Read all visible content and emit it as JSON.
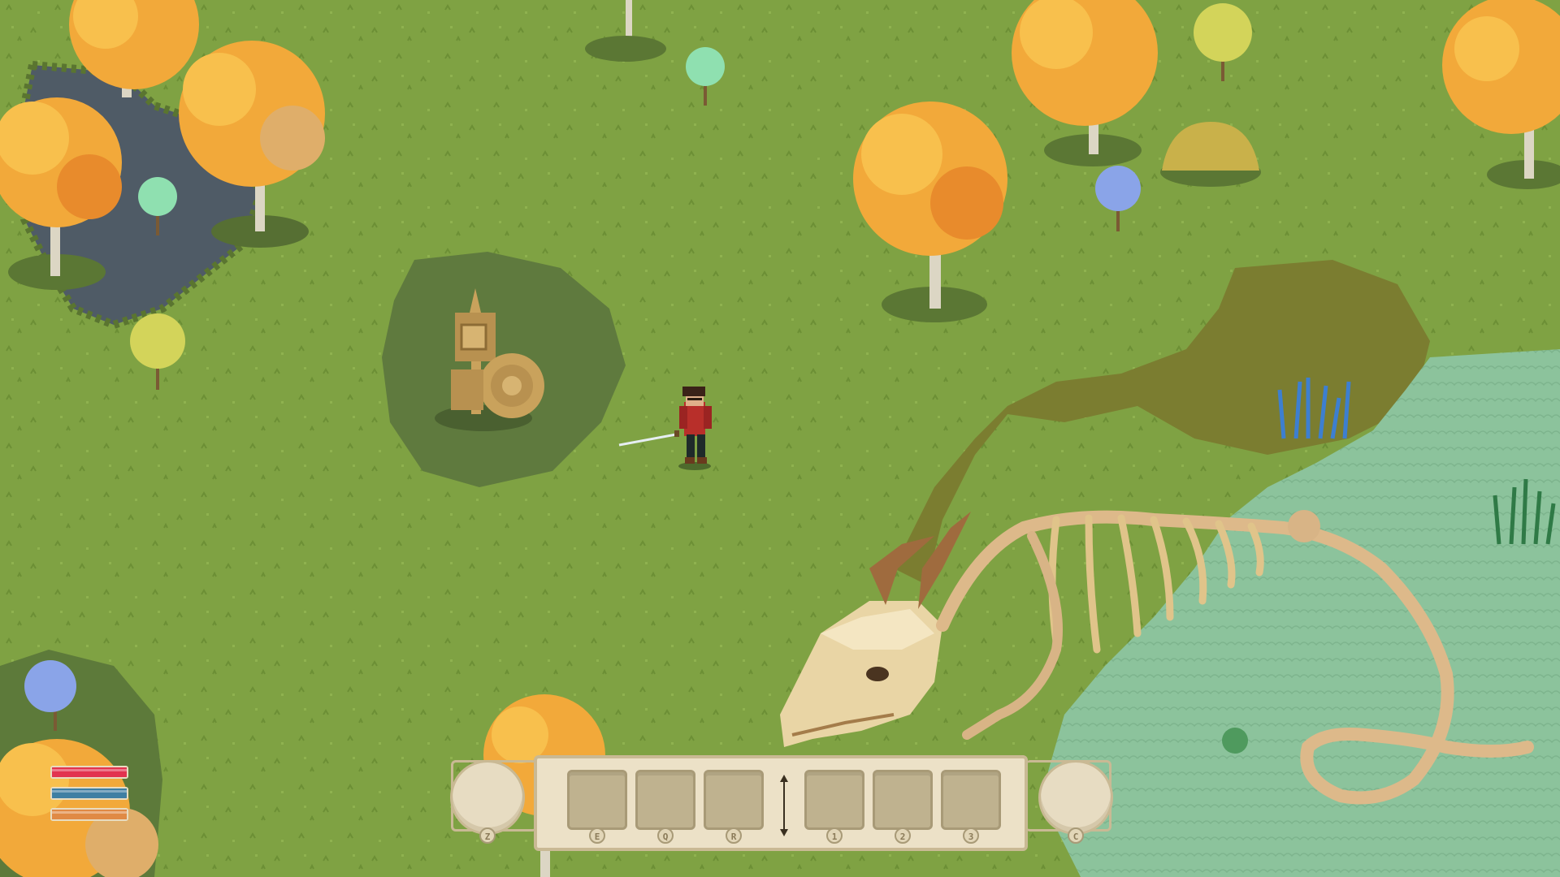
{
  "hud": {
    "status_bars": [
      {
        "name": "health",
        "color": "#e2334f",
        "fill": 1.0
      },
      {
        "name": "mana",
        "color": "#3f7fa3",
        "fill": 1.0
      },
      {
        "name": "stamina",
        "color": "#e08a45",
        "fill": 1.0
      }
    ],
    "hotbar": {
      "left_circle_key": "Z",
      "right_circle_key": "C",
      "slots": [
        {
          "key": "E"
        },
        {
          "key": "Q"
        },
        {
          "key": "R"
        },
        {
          "key": "1"
        },
        {
          "key": "2"
        },
        {
          "key": "3"
        }
      ]
    }
  },
  "scene": {
    "colors": {
      "grass": "#7fa243",
      "grass_dark": "#6e8f3a",
      "pond_dark": "#4e5a62",
      "swamp": "#8fc7a0",
      "mud": "#7a7a2e",
      "tree_orange": "#f2a93a",
      "bone": "#e0c48a"
    }
  }
}
